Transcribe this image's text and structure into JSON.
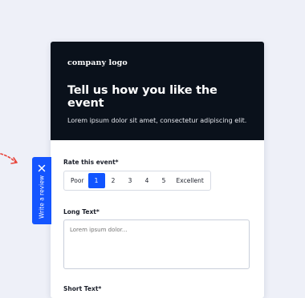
{
  "header": {
    "logo": "company logo",
    "title": "Tell us how you like the event",
    "subtitle": "Lorem ipsum dolor sit amet, consectetur adipiscing elit."
  },
  "rating": {
    "label": "Rate this event*",
    "low_label": "Poor",
    "options": [
      "1",
      "2",
      "3",
      "4",
      "5"
    ],
    "high_label": "Excellent",
    "selected": "1"
  },
  "long_text": {
    "label": "Long Text*",
    "placeholder": "Lorem ipsum dolor..."
  },
  "short_text": {
    "label": "Short Text*"
  },
  "review_tab": {
    "label": "Write a review",
    "close_icon": "close-icon"
  },
  "colors": {
    "header_bg": "#0a111b",
    "accent": "#1455ff",
    "arrow": "#e8453c"
  }
}
